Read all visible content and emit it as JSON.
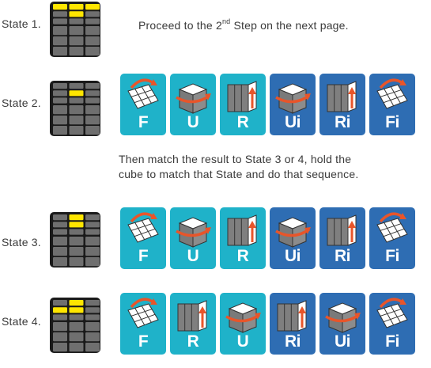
{
  "states": [
    {
      "label": "State 1.",
      "top_face": [
        "yellow",
        "yellow",
        "yellow",
        "gray",
        "yellow",
        "gray",
        "gray",
        "gray",
        "gray"
      ]
    },
    {
      "label": "State 2.",
      "top_face": [
        "gray",
        "gray",
        "gray",
        "gray",
        "yellow",
        "gray",
        "gray",
        "gray",
        "gray"
      ]
    },
    {
      "label": "State 3.",
      "top_face": [
        "gray",
        "yellow",
        "gray",
        "gray",
        "yellow",
        "gray",
        "gray",
        "gray",
        "gray"
      ]
    },
    {
      "label": "State 4.",
      "top_face": [
        "gray",
        "yellow",
        "gray",
        "yellow",
        "yellow",
        "gray",
        "gray",
        "gray",
        "gray"
      ]
    }
  ],
  "step1_note": {
    "before": "Proceed to the 2",
    "sup": "nd",
    "after": " Step on the next page."
  },
  "step2_note": {
    "line1": "Then match the result to State 3 or 4, hold the",
    "line2": "cube to match that State and do that sequence."
  },
  "sequences": {
    "state2": [
      {
        "move": "F",
        "art": "front",
        "color": "teal"
      },
      {
        "move": "U",
        "art": "up",
        "color": "teal"
      },
      {
        "move": "R",
        "art": "right",
        "color": "teal"
      },
      {
        "move": "Ui",
        "art": "up",
        "color": "blue"
      },
      {
        "move": "Ri",
        "art": "right",
        "color": "blue"
      },
      {
        "move": "Fi",
        "art": "front",
        "color": "blue"
      }
    ],
    "state3": [
      {
        "move": "F",
        "art": "front",
        "color": "teal"
      },
      {
        "move": "U",
        "art": "up",
        "color": "teal"
      },
      {
        "move": "R",
        "art": "right",
        "color": "teal"
      },
      {
        "move": "Ui",
        "art": "up",
        "color": "blue"
      },
      {
        "move": "Ri",
        "art": "right",
        "color": "blue"
      },
      {
        "move": "Fi",
        "art": "front",
        "color": "blue"
      }
    ],
    "state4": [
      {
        "move": "F",
        "art": "front",
        "color": "teal"
      },
      {
        "move": "R",
        "art": "right",
        "color": "teal"
      },
      {
        "move": "U",
        "art": "up",
        "color": "teal"
      },
      {
        "move": "Ri",
        "art": "right",
        "color": "blue"
      },
      {
        "move": "Ui",
        "art": "up",
        "color": "blue"
      },
      {
        "move": "Fi",
        "art": "front",
        "color": "blue"
      }
    ]
  },
  "colors": {
    "yellow": "#ffe600",
    "gray": "#6f6f6f",
    "teal": "#1fb2c9",
    "blue": "#2e6db3",
    "arrow": "#e8552a"
  }
}
